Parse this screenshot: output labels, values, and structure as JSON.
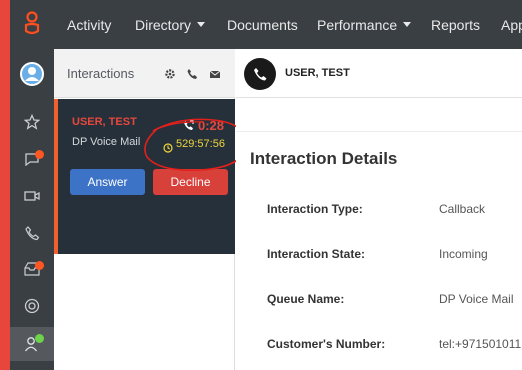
{
  "topnav": {
    "items": [
      {
        "label": "Activity"
      },
      {
        "label": "Directory"
      },
      {
        "label": "Documents"
      },
      {
        "label": "Performance"
      },
      {
        "label": "Reports"
      },
      {
        "label": "App"
      }
    ]
  },
  "rail": {
    "icons": [
      "genesys-logo-icon",
      "avatar",
      "star-icon",
      "chat-icon",
      "video-icon",
      "phone-icon",
      "inbox-icon",
      "lifebuoy-icon",
      "agent-status-icon"
    ]
  },
  "panel": {
    "title": "Interactions",
    "header_icons": [
      "gear-icon",
      "phone-icon",
      "envelope-icon"
    ],
    "card": {
      "name": "USER, TEST",
      "queue": "DP Voice Mail",
      "timer": "0:28",
      "elapsed": "529:57:56",
      "answer_label": "Answer",
      "decline_label": "Decline"
    }
  },
  "main": {
    "contact_name": "USER, TEST",
    "section_title": "Interaction Details",
    "details": [
      {
        "label": "Interaction Type:",
        "value": "Callback"
      },
      {
        "label": "Interaction State:",
        "value": "Incoming"
      },
      {
        "label": "Queue Name:",
        "value": "DP Voice Mail"
      },
      {
        "label": "Customer's Number:",
        "value": "tel:+971501011"
      }
    ]
  },
  "colors": {
    "rail_bg": "#3a3f44",
    "accent_red": "#e8453c",
    "card_bg": "#25303a",
    "answer_blue": "#3d73c7",
    "timer_yellow": "#f0d53c"
  }
}
